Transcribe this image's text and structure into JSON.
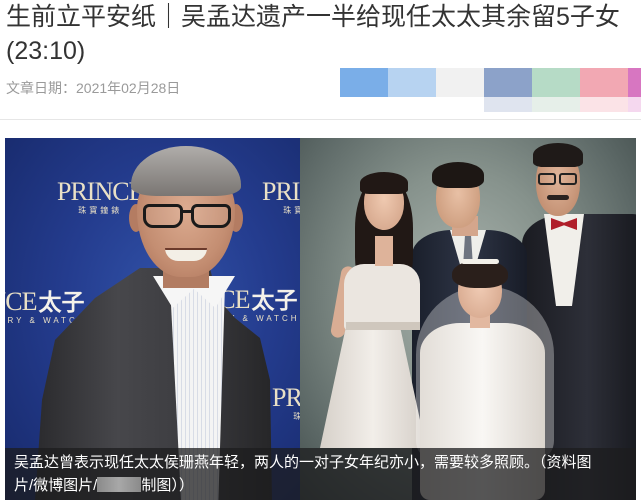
{
  "article": {
    "title": {
      "line1": "生前立平安纸｜吴孟达遗产一半给现任太太其余留5子女",
      "line2": "(23:10)"
    },
    "date": "文章日期：2021年02月28日"
  },
  "share_bar": {
    "row1_colors": [
      "#7aaee8",
      "#b7d3f1",
      "#f1f1f1",
      "#8ca2c9",
      "#b6dbc6",
      "#f2a8b3",
      "#d776c1"
    ],
    "row2_colors": [
      null,
      null,
      null,
      "#dfe4ef",
      "#e6efe9",
      "#fbe3e7",
      "#f5d8ef"
    ]
  },
  "photo": {
    "backdrop_logo": {
      "name": "PRINCE",
      "name_cn": "太子",
      "tagline_cn": "珠寶鐘錶",
      "tagline_en": "JEWELLERY & WATCH"
    },
    "caption": {
      "line1": "吴孟达曾表示现任太太侯珊燕年轻，两人的一对子女年纪亦小，需要较多照顾。（资料图",
      "line2_before_redaction": "片/微博图片/",
      "line2_after_redaction": "制图））"
    }
  }
}
